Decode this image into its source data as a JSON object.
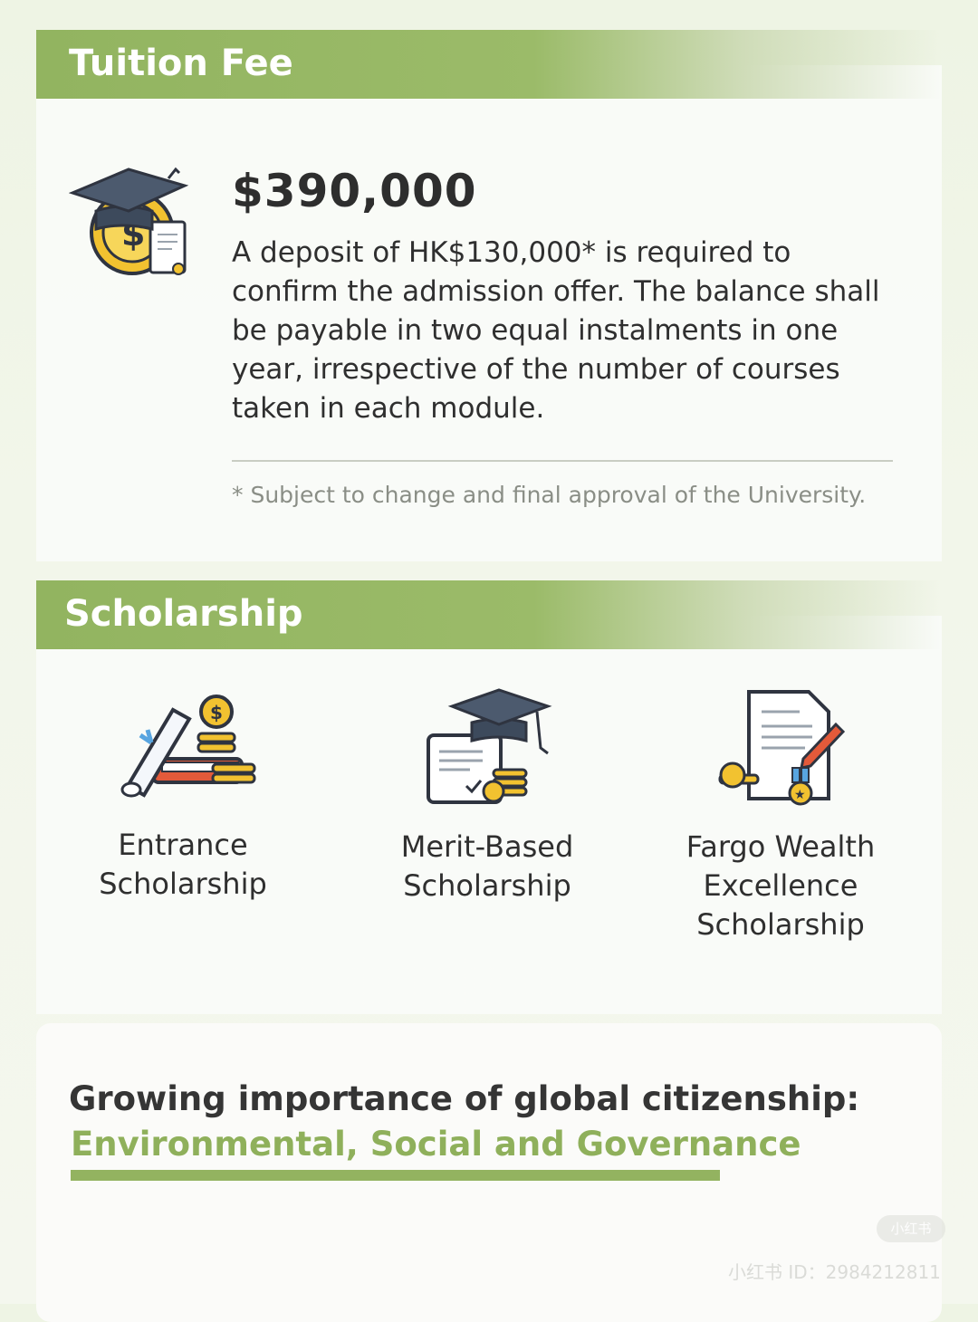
{
  "tuition": {
    "section_title": "Tuition Fee",
    "icon": "graduation-cap-coin-certificate-icon",
    "price": "$390,000",
    "description": "A deposit of HK$130,000* is required to confirm the admission offer. The balance shall be payable in two equal instalments in one year, irrespective of the number of courses taken in each module.",
    "note": "* Subject to change and final approval of the University."
  },
  "scholarship": {
    "section_title": "Scholarship",
    "items": [
      {
        "label": "Entrance Scholarship",
        "icon": "diploma-books-coins-icon"
      },
      {
        "label": "Merit-Based Scholarship",
        "icon": "certificate-cap-coins-icon"
      },
      {
        "label": "Fargo Wealth Excellence Scholarship",
        "icon": "document-pen-medal-coins-icon"
      }
    ]
  },
  "esg": {
    "line1": "Growing importance of global citizenship:",
    "line2": "Environmental, Social and Governance"
  },
  "watermark": {
    "badge": "小红书",
    "id_text": "小红书 ID：2984212811"
  },
  "colors": {
    "accent": "#93b360",
    "header_text": "#ffffff",
    "coin": "#f2c230"
  }
}
